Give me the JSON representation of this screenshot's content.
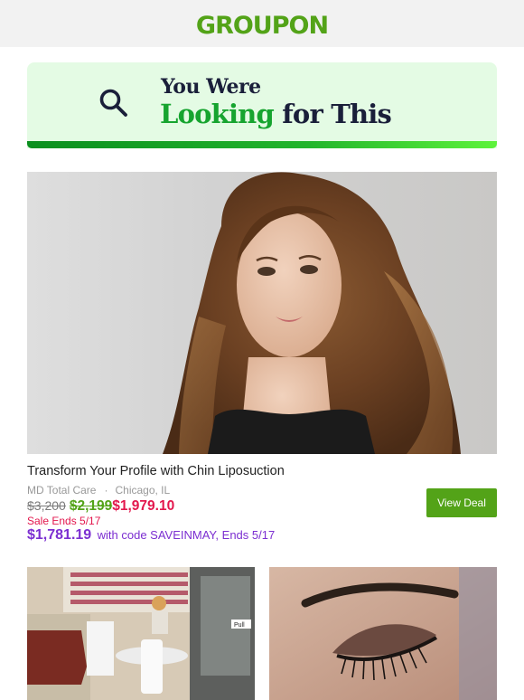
{
  "header": {
    "logo_text": "GROUPON"
  },
  "banner": {
    "line1": "You Were",
    "line2_green": "Looking",
    "line2_rest": "for This"
  },
  "deal": {
    "title": "Transform Your Profile with Chin Liposuction",
    "merchant": "MD Total Care",
    "separator": "·",
    "location": "Chicago, IL",
    "price_original": "$3,200",
    "price_strikethrough": "$2,199",
    "price_sale": "$1,979.10",
    "sale_ends": "Sale Ends 5/17",
    "code_price": "$1,781.19",
    "code_text": "with code SAVEINMAY, Ends 5/17",
    "view_label": "View Deal"
  },
  "colors": {
    "brand_green": "#53a318",
    "sale_red": "#e3174d",
    "promo_purple": "#7c2fd1",
    "banner_bg": "#e4fbe4"
  },
  "icons": {
    "banner_icon": "search-icon"
  }
}
